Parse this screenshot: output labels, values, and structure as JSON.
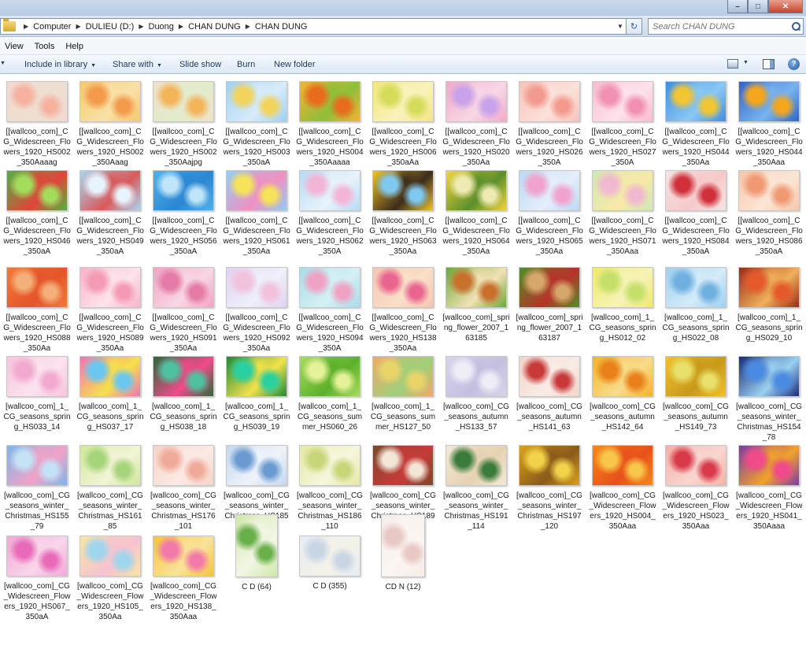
{
  "window": {
    "controls": {
      "minimize": "–",
      "maximize": "□",
      "close": "✕"
    }
  },
  "address": {
    "breadcrumbs": [
      "Computer",
      "DULIEU (D:)",
      "Duong",
      "CHAN DUNG",
      "CHAN DUNG"
    ],
    "search_placeholder": "Search CHAN DUNG"
  },
  "menu": [
    "View",
    "Tools",
    "Help"
  ],
  "toolbar": {
    "include_label": "Include in library",
    "share_label": "Share with",
    "slideshow_label": "Slide show",
    "burn_label": "Burn",
    "newfolder_label": "New folder"
  },
  "files": [
    {
      "name": "[[wallcoo_com]_CG_Widescreen_Flowers_1920_HS002_350Aaaag",
      "colors": [
        "#f2d9d0",
        "#f6b19f",
        "#eedfd2"
      ]
    },
    {
      "name": "[[wallcoo_com]_CG_Widescreen_Flowers_1920_HS002_350Aaag",
      "colors": [
        "#f5c96e",
        "#f39a4b",
        "#f8e1a6"
      ]
    },
    {
      "name": "[[wallcoo_com]_CG_Widescreen_Flowers_1920_HS002_350Aajpg",
      "colors": [
        "#efe0c6",
        "#f4b45a",
        "#e2eccd"
      ]
    },
    {
      "name": "[[wallcoo_com]_CG_Widescreen_Flowers_1920_HS003_350aA",
      "colors": [
        "#9fd0f2",
        "#f2d35c",
        "#d8ecfa"
      ]
    },
    {
      "name": "[[wallcoo_com]_CG_Widescreen_Flowers_1920_HS004_350Aaaaa",
      "colors": [
        "#f7b233",
        "#e96b1e",
        "#8dbf3a"
      ]
    },
    {
      "name": "[[wallcoo_com]_CG_Widescreen_Flowers_1920_HS006_350aAa",
      "colors": [
        "#f3e57e",
        "#d5dc5a",
        "#f9f2bd"
      ]
    },
    {
      "name": "[[wallcoo_com]_CG_Widescreen_Flowers_1920_HS020_350Aa",
      "colors": [
        "#f3a9c7",
        "#c8a2ea",
        "#f7d7e6"
      ]
    },
    {
      "name": "[[wallcoo_com]_CG_Widescreen_Flowers_1920_HS026_350A",
      "colors": [
        "#f6c3bb",
        "#f39a8e",
        "#fbe1da"
      ]
    },
    {
      "name": "[[wallcoo_com]_CG_Widescreen_Flowers_1920_HS027_350A",
      "colors": [
        "#f7bcd0",
        "#f190b2",
        "#fde2ec"
      ]
    },
    {
      "name": "[[wallcoo_com]_CG_Widescreen_Flowers_1920_HS044_350Aa",
      "colors": [
        "#3f8ee0",
        "#f2c532",
        "#8ac8f4"
      ]
    },
    {
      "name": "[[wallcoo_com]_CG_Widescreen_Flowers_1920_HS044_350Aaa",
      "colors": [
        "#2f64c8",
        "#f4a71c",
        "#79b3ee"
      ]
    },
    {
      "name": "[[wallcoo_com]_CG_Widescreen_Flowers_1920_HS046_350aA",
      "colors": [
        "#4db344",
        "#a4dc5c",
        "#e1453a"
      ]
    },
    {
      "name": "[[wallcoo_com]_CG_Widescreen_Flowers_1920_HS049_350aA",
      "colors": [
        "#a8d6f2",
        "#e8f4fb",
        "#d95a5a"
      ]
    },
    {
      "name": "[[wallcoo_com]_CG_Widescreen_Flowers_1920_HS056_350aA",
      "colors": [
        "#4fb2ea",
        "#bfe6f8",
        "#2c86d2"
      ]
    },
    {
      "name": "[[wallcoo_com]_CG_Widescreen_Flowers_1920_HS061_350Aa",
      "colors": [
        "#8fd0f4",
        "#f6e35a",
        "#f090c0"
      ]
    },
    {
      "name": "[[wallcoo_com]_CG_Widescreen_Flowers_1920_HS062_350A",
      "colors": [
        "#b5dcf6",
        "#f3b5d6",
        "#e8f3fb"
      ]
    },
    {
      "name": "[[wallcoo_com]_CG_Widescreen_Flowers_1920_HS063_350Aa",
      "colors": [
        "#f3c32a",
        "#7fc8ee",
        "#3b2c1c"
      ]
    },
    {
      "name": "[[wallcoo_com]_CG_Widescreen_Flowers_1920_HS064_350Aa",
      "colors": [
        "#f6d53a",
        "#efe9b2",
        "#5a8f2c"
      ]
    },
    {
      "name": "[[wallcoo_com]_CG_Widescreen_Flowers_1920_HS065_350Aa",
      "colors": [
        "#b9d9f4",
        "#f1a2cf",
        "#e5eefa"
      ]
    },
    {
      "name": "[[wallcoo_com]_CG_Widescreen_Flowers_1920_HS071_350Aaa",
      "colors": [
        "#cfe8b4",
        "#f1b9cf",
        "#f7e9a8"
      ]
    },
    {
      "name": "[[wallcoo_com]_CG_Widescreen_Flowers_1920_HS084_350aA",
      "colors": [
        "#f4e4e4",
        "#d0303a",
        "#f6c9c9"
      ]
    },
    {
      "name": "[[wallcoo_com]_CG_Widescreen_Flowers_1920_HS086_350aA",
      "colors": [
        "#f7c6aa",
        "#f09a74",
        "#fbe6d6"
      ]
    },
    {
      "name": "[[wallcoo_com]_CG_Widescreen_Flowers_1920_HS088_350Aa",
      "colors": [
        "#f07a3a",
        "#f4b07a",
        "#e5542a"
      ]
    },
    {
      "name": "[[wallcoo_com]_CG_Widescreen_Flowers_1920_HS089_350Aa",
      "colors": [
        "#f7b4c8",
        "#f49ab5",
        "#fde3eb"
      ]
    },
    {
      "name": "[[wallcoo_com]_CG_Widescreen_Flowers_1920_HS091_350Aa",
      "colors": [
        "#f0a4c2",
        "#e47aa5",
        "#f8d6e4"
      ]
    },
    {
      "name": "[[wallcoo_com]_CG_Widescreen_Flowers_1920_HS092_350Aa",
      "colors": [
        "#e1d2f2",
        "#f2c1dc",
        "#eef0fa"
      ]
    },
    {
      "name": "[[wallcoo_com]_CG_Widescreen_Flowers_1920_HS094_350A",
      "colors": [
        "#a6dde8",
        "#f0a2c4",
        "#d5f0f4"
      ]
    },
    {
      "name": "[[wallcoo_com]_CG_Widescreen_Flowers_1920_HS138_350Aa",
      "colors": [
        "#f5c5b2",
        "#e9658f",
        "#f9dfc9"
      ]
    },
    {
      "name": "[wallcoo_com]_spring_flower_2007_163185",
      "colors": [
        "#6aa83a",
        "#c8702c",
        "#f2e2b5"
      ]
    },
    {
      "name": "[wallcoo_com]_spring_flower_2007_163187",
      "colors": [
        "#4e8f2a",
        "#d7a66a",
        "#b8322a"
      ]
    },
    {
      "name": "[wallcoo_com]_1_CG_seasons_spring_HS012_02",
      "colors": [
        "#f1e96a",
        "#c4e06a",
        "#f6f3b8"
      ]
    },
    {
      "name": "[wallcoo_com]_1_CG_seasons_spring_HS022_08",
      "colors": [
        "#9fd0ef",
        "#6fb0e0",
        "#d4ebf8"
      ]
    },
    {
      "name": "[wallcoo_com]_1_CG_seasons_spring_HS029_10",
      "colors": [
        "#9a2a1a",
        "#e55a2a",
        "#f0b05a"
      ]
    },
    {
      "name": "[wallcoo_com]_1_CG_seasons_spring_HS033_14",
      "colors": [
        "#f7c4de",
        "#f2a9cf",
        "#fbe3ef"
      ]
    },
    {
      "name": "[wallcoo_com]_1_CG_seasons_spring_HS037_17",
      "colors": [
        "#f273b8",
        "#6bc7f0",
        "#f6e14a"
      ]
    },
    {
      "name": "[wallcoo_com]_1_CG_seasons_spring_HS038_18",
      "colors": [
        "#2a6a3a",
        "#4fc0a0",
        "#f24a8a"
      ]
    },
    {
      "name": "[wallcoo_com]_1_CG_seasons_spring_HS039_19",
      "colors": [
        "#1c8a3a",
        "#2ad0a0",
        "#f2e24a"
      ]
    },
    {
      "name": "[wallcoo_com]_1_CG_seasons_summer_HS060_26",
      "colors": [
        "#a7dc5a",
        "#e6f29a",
        "#5cb02a"
      ]
    },
    {
      "name": "[wallcoo_com]_1_CG_seasons_summer_HS127_50",
      "colors": [
        "#f2a86a",
        "#e9d46a",
        "#9fd07a"
      ]
    },
    {
      "name": "[wallcoo_com]_CG_seasons_autumn_HS133_57",
      "colors": [
        "#d8d4ea",
        "#efeef7",
        "#c4bfe0"
      ]
    },
    {
      "name": "[wallcoo_com]_CG_seasons_autumn_HS141_63",
      "colors": [
        "#f2d4c8",
        "#c83a3a",
        "#f8ece6"
      ]
    },
    {
      "name": "[wallcoo_com]_CG_seasons_autumn_HS142_64",
      "colors": [
        "#f2b42a",
        "#e9801a",
        "#f8dc8a"
      ]
    },
    {
      "name": "[wallcoo_com]_CG_seasons_autumn_HS149_73",
      "colors": [
        "#f2c02a",
        "#e8e06a",
        "#c89a1a"
      ]
    },
    {
      "name": "[wallcoo_com]_CG_seasons_winter_Christmas_HS154_78",
      "colors": [
        "#1a2a7a",
        "#4a8ae0",
        "#9ad0f0"
      ]
    },
    {
      "name": "[wallcoo_com]_CG_seasons_winter_Christmas_HS155_79",
      "colors": [
        "#7ab8ea",
        "#c4e2f6",
        "#f2a2c8"
      ]
    },
    {
      "name": "[wallcoo_com]_CG_seasons_winter_Christmas_HS161_85",
      "colors": [
        "#d0e89a",
        "#a6d47a",
        "#f2f4d6"
      ]
    },
    {
      "name": "[wallcoo_com]_CG_seasons_winter_Christmas_HS176_101",
      "colors": [
        "#f6d2c6",
        "#f0aa9a",
        "#fbeae4"
      ]
    },
    {
      "name": "[wallcoo_com]_CG_seasons_winter_Christmas_HS185_109",
      "colors": [
        "#c4d8ee",
        "#6a9ad0",
        "#eef3fa"
      ]
    },
    {
      "name": "[wallcoo_com]_CG_seasons_winter_Christmas_HS186_110",
      "colors": [
        "#e6e8a6",
        "#c8d67a",
        "#f6f6dc"
      ]
    },
    {
      "name": "[wallcoo_com]_CG_seasons_winter_Christmas_HS189_112",
      "colors": [
        "#7a4a2a",
        "#f2e6d6",
        "#c83a3a"
      ]
    },
    {
      "name": "[wallcoo_com]_CG_seasons_winter_Christmas_HS191_114",
      "colors": [
        "#f2ead6",
        "#3a7a3a",
        "#e6d2b2"
      ]
    },
    {
      "name": "[wallcoo_com]_CG_seasons_winter_Christmas_HS197_120",
      "colors": [
        "#d8a21a",
        "#f2d24a",
        "#8a5a1a"
      ]
    },
    {
      "name": "[wallcoo_com]_CG_Widescreen_Flowers_1920_HS004_350Aaa",
      "colors": [
        "#f28a1a",
        "#f7c64a",
        "#e8501a"
      ]
    },
    {
      "name": "[wallcoo_com]_CG_Widescreen_Flowers_1920_HS023_350Aaa",
      "colors": [
        "#f4b0a6",
        "#d83a4a",
        "#f8d6d0"
      ]
    },
    {
      "name": "[wallcoo_com]_CG_Widescreen_Flowers_1920_HS041_350Aaaa",
      "colors": [
        "#7a3aa8",
        "#f04a8a",
        "#f2a22a"
      ]
    },
    {
      "name": "[wallcoo_com]_CG_Widescreen_Flowers_1920_HS067_350aA",
      "colors": [
        "#f2a8d6",
        "#e86ab8",
        "#f8d6ea"
      ]
    },
    {
      "name": "[wallcoo_com]_CG_Widescreen_Flowers_1920_HS105_350Aa",
      "colors": [
        "#f7e6a2",
        "#9fd6ee",
        "#f6c2d2"
      ]
    },
    {
      "name": "[wallcoo_com]_CG_Widescreen_Flowers_1920_HS138_350Aaa",
      "colors": [
        "#f6c43a",
        "#f27aa8",
        "#f9e29a"
      ]
    },
    {
      "name": "C D (64)",
      "colors": [
        "#cfe8a8",
        "#6ab04a",
        "#f2f6e6"
      ]
    },
    {
      "name": "C D (355)",
      "colors": [
        "#e6ecf2",
        "#c8d6e4",
        "#f4f2e8"
      ]
    },
    {
      "name": "CD N (12)",
      "colors": [
        "#f6ece8",
        "#e8c8c4",
        "#fbf6f2"
      ]
    }
  ]
}
